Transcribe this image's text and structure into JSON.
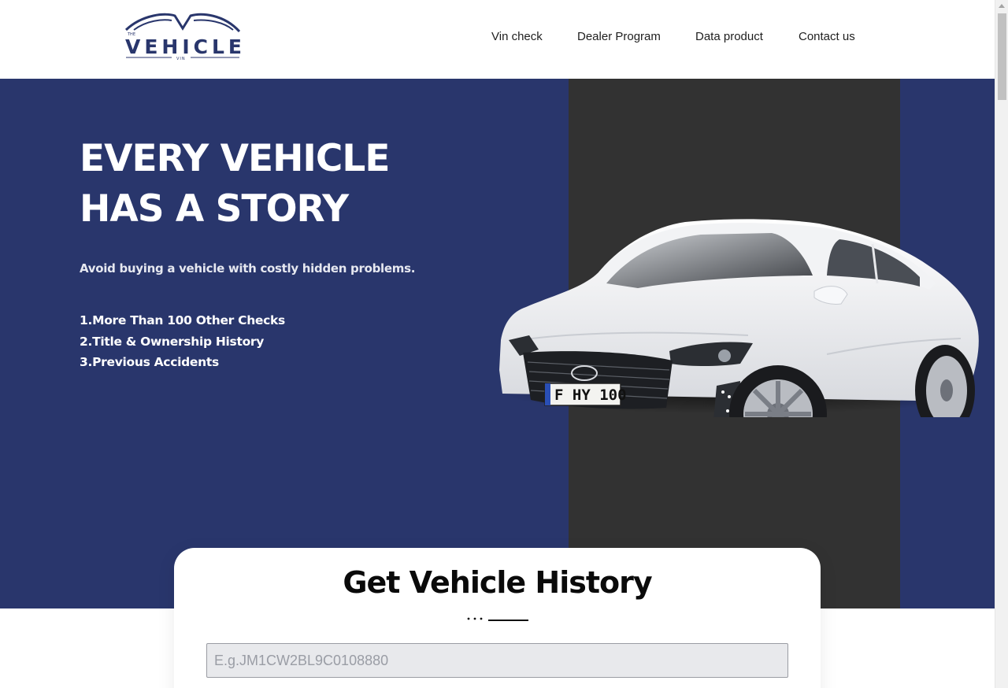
{
  "brand": {
    "logo_top": "THE",
    "logo_main": "VEHICLE",
    "logo_bottom": "VIN",
    "brand_color": "#29366c"
  },
  "nav": {
    "items": [
      {
        "label": "Vin check"
      },
      {
        "label": "Dealer Program"
      },
      {
        "label": "Data product"
      },
      {
        "label": "Contact us"
      }
    ]
  },
  "hero": {
    "title_line1": "EVERY VEHICLE",
    "title_line2": "HAS A STORY",
    "subtitle": "Avoid buying a vehicle with costly hidden problems.",
    "features": [
      "1.More Than 100 Other Checks",
      "2.Title & Ownership History",
      "3.Previous Accidents"
    ],
    "plate_text": "F HY 100",
    "bg_color": "#29366c",
    "panel_color": "#323232"
  },
  "vin_card": {
    "title": "Get Vehicle History",
    "input_placeholder": "E.g.JM1CW2BL9C0108880",
    "input_value": ""
  }
}
